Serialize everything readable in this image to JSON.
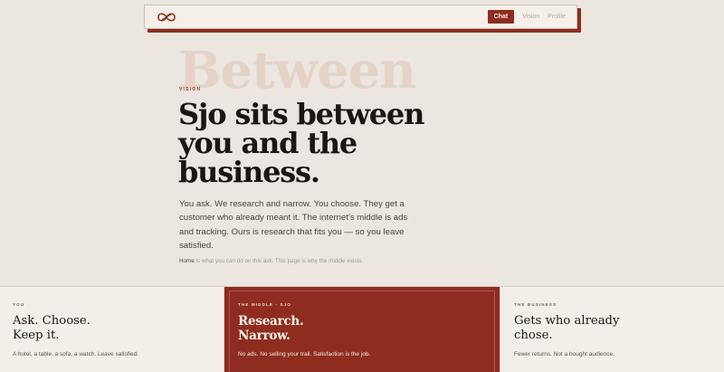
{
  "nav": {
    "logo_icon": "infinity-loop-icon",
    "links": [
      {
        "label": "Chat",
        "active": true
      },
      {
        "label": "Vision",
        "active": false
      },
      {
        "label": "Profile",
        "active": false
      }
    ]
  },
  "hero": {
    "background_word": "Between",
    "eyebrow": "VISION",
    "headline": "Sjo sits between you and the business.",
    "lede": "You ask. We research and narrow. You choose. They get a customer who already meant it. The internet's middle is ads and tracking. Ours is research that fits you — so you leave satisfied.",
    "footnote_link": "Home",
    "footnote_text": " is what you can do on this ask. This page is why the middle exists."
  },
  "cards": [
    {
      "kicker": "YOU",
      "title_line1": "Ask. Choose.",
      "title_line2": "Keep it.",
      "body": "A hotel, a table, a sofa, a watch. Leave satisfied."
    },
    {
      "kicker": "THE MIDDLE · SJO",
      "title_line1": "Research.",
      "title_line2": "Narrow.",
      "body": "No ads. No selling your trail. Satisfaction is the job."
    },
    {
      "kicker": "THE BUSINESS",
      "title": "Gets who already chose.",
      "body": "Fewer returns. Not a bought audience."
    }
  ],
  "colors": {
    "background": "#ebe6df",
    "accent": "#8e2d1f",
    "card": "#f3efe8"
  }
}
